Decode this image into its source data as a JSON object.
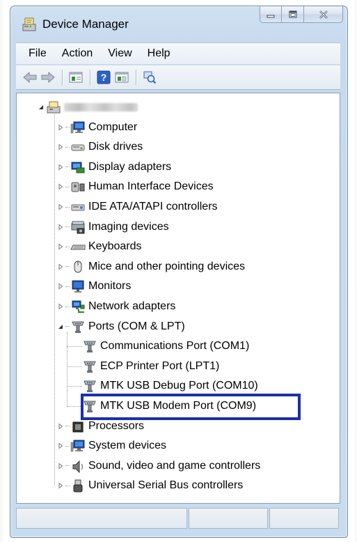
{
  "window": {
    "title": "Device Manager",
    "title_icon": "device-manager-icon"
  },
  "caption_buttons": [
    "minimize-icon",
    "maximize-icon",
    "close-icon"
  ],
  "menu": [
    "File",
    "Action",
    "View",
    "Help"
  ],
  "toolbar": [
    "back-arrow-icon",
    "forward-arrow-icon",
    "properties-icon",
    "help-icon",
    "update-driver-icon",
    "scan-hardware-icon"
  ],
  "tree": {
    "root_label": "",
    "root_icon": "computer-root-icon",
    "categories": [
      {
        "label": "Computer",
        "icon": "computer-icon",
        "expanded": false
      },
      {
        "label": "Disk drives",
        "icon": "disk-drive-icon",
        "expanded": false
      },
      {
        "label": "Display adapters",
        "icon": "display-adapter-icon",
        "expanded": false
      },
      {
        "label": "Human Interface Devices",
        "icon": "hid-icon",
        "expanded": false
      },
      {
        "label": "IDE ATA/ATAPI controllers",
        "icon": "ide-controller-icon",
        "expanded": false
      },
      {
        "label": "Imaging devices",
        "icon": "imaging-device-icon",
        "expanded": false
      },
      {
        "label": "Keyboards",
        "icon": "keyboard-icon",
        "expanded": false
      },
      {
        "label": "Mice and other pointing devices",
        "icon": "mouse-icon",
        "expanded": false
      },
      {
        "label": "Monitors",
        "icon": "monitor-icon",
        "expanded": false
      },
      {
        "label": "Network adapters",
        "icon": "network-adapter-icon",
        "expanded": false
      },
      {
        "label": "Ports (COM & LPT)",
        "icon": "port-icon",
        "expanded": true
      },
      {
        "label": "Processors",
        "icon": "processor-icon",
        "expanded": false
      },
      {
        "label": "System devices",
        "icon": "system-device-icon",
        "expanded": false
      },
      {
        "label": "Sound, video and game controllers",
        "icon": "speaker-icon",
        "expanded": false
      },
      {
        "label": "Universal Serial Bus controllers",
        "icon": "usb-icon",
        "expanded": false
      }
    ],
    "ports_children": [
      {
        "label": "Communications Port (COM1)",
        "icon": "port-icon"
      },
      {
        "label": "ECP Printer Port (LPT1)",
        "icon": "port-icon"
      },
      {
        "label": "MTK USB Debug Port (COM10)",
        "icon": "port-icon"
      },
      {
        "label": "MTK USB Modem Port (COM9)",
        "icon": "port-icon",
        "highlighted": true
      }
    ],
    "highlight_color": "#1a2fae"
  },
  "colors": {
    "window_frame": "#c6d9ee",
    "highlight_border": "#1a2fae"
  }
}
